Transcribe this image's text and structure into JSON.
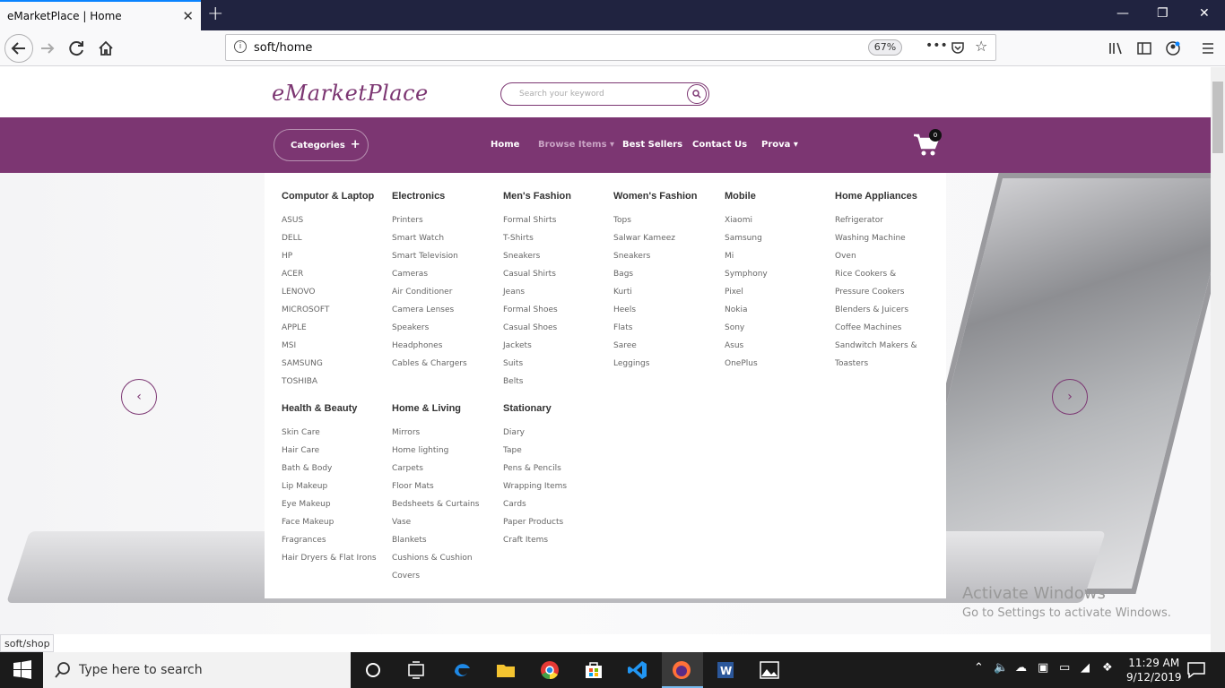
{
  "browser": {
    "tab_title": "eMarketPlace | Home",
    "url": "soft/home",
    "zoom": "67%"
  },
  "site": {
    "logo": "eMarketPlace",
    "search_placeholder": "Search your keyword",
    "brand_color": "#7c3672"
  },
  "nav": {
    "categories_label": "Categories",
    "home": "Home",
    "browse_items": "Browse Items",
    "best_sellers": "Best Sellers",
    "contact_us": "Contact Us",
    "prova": "Prova",
    "cart_count": "0"
  },
  "mega_menu": [
    {
      "title": "Computor & Laptop",
      "items": [
        "ASUS",
        "DELL",
        "HP",
        "ACER",
        "LENOVO",
        "MICROSOFT",
        "APPLE",
        "MSI",
        "SAMSUNG",
        "TOSHIBA"
      ]
    },
    {
      "title": "Electronics",
      "items": [
        "Printers",
        "Smart Watch",
        "Smart Television",
        "Cameras",
        "Air Conditioner",
        "Camera Lenses",
        "Speakers",
        "Headphones",
        "Cables & Chargers"
      ]
    },
    {
      "title": "Men's Fashion",
      "items": [
        "Formal Shirts",
        "T-Shirts",
        "Sneakers",
        "Casual Shirts",
        "Jeans",
        "Formal Shoes",
        "Casual Shoes",
        "Jackets",
        "Suits",
        "Belts"
      ]
    },
    {
      "title": "Women's Fashion",
      "items": [
        "Tops",
        "Salwar Kameez",
        "Sneakers",
        "Bags",
        "Kurti",
        "Heels",
        "Flats",
        "Saree",
        "Leggings"
      ]
    },
    {
      "title": "Mobile",
      "items": [
        "Xiaomi",
        "Samsung",
        "Mi",
        "Symphony",
        "Pixel",
        "Nokia",
        "Sony",
        "Asus",
        "OnePlus"
      ]
    },
    {
      "title": "Home Appliances",
      "items": [
        "Refrigerator",
        "Washing Machine",
        "Oven",
        "Rice Cookers &",
        "Pressure Cookers",
        "Blenders & Juicers",
        "Coffee Machines",
        "Sandwitch Makers &",
        "Toasters"
      ]
    },
    {
      "title": "Health & Beauty",
      "items": [
        "Skin Care",
        "Hair Care",
        "Bath & Body",
        "Lip Makeup",
        "Eye Makeup",
        "Face Makeup",
        "Fragrances",
        "Hair Dryers & Flat Irons"
      ]
    },
    {
      "title": "Home & Living",
      "items": [
        "Mirrors",
        "Home lighting",
        "Carpets",
        "Floor Mats",
        "Bedsheets & Curtains",
        "Vase",
        "Blankets",
        "Cushions & Cushion",
        "Covers"
      ]
    },
    {
      "title": "Stationary",
      "items": [
        "Diary",
        "Tape",
        "Pens & Pencils",
        "Wrapping Items",
        "Cards",
        "Paper Products",
        "Craft Items"
      ]
    }
  ],
  "watermark": {
    "line1": "Activate Windows",
    "line2": "Go to Settings to activate Windows."
  },
  "status_url": "soft/shop",
  "taskbar": {
    "search_placeholder": "Type here to search",
    "time": "11:29 AM",
    "date": "9/12/2019"
  }
}
